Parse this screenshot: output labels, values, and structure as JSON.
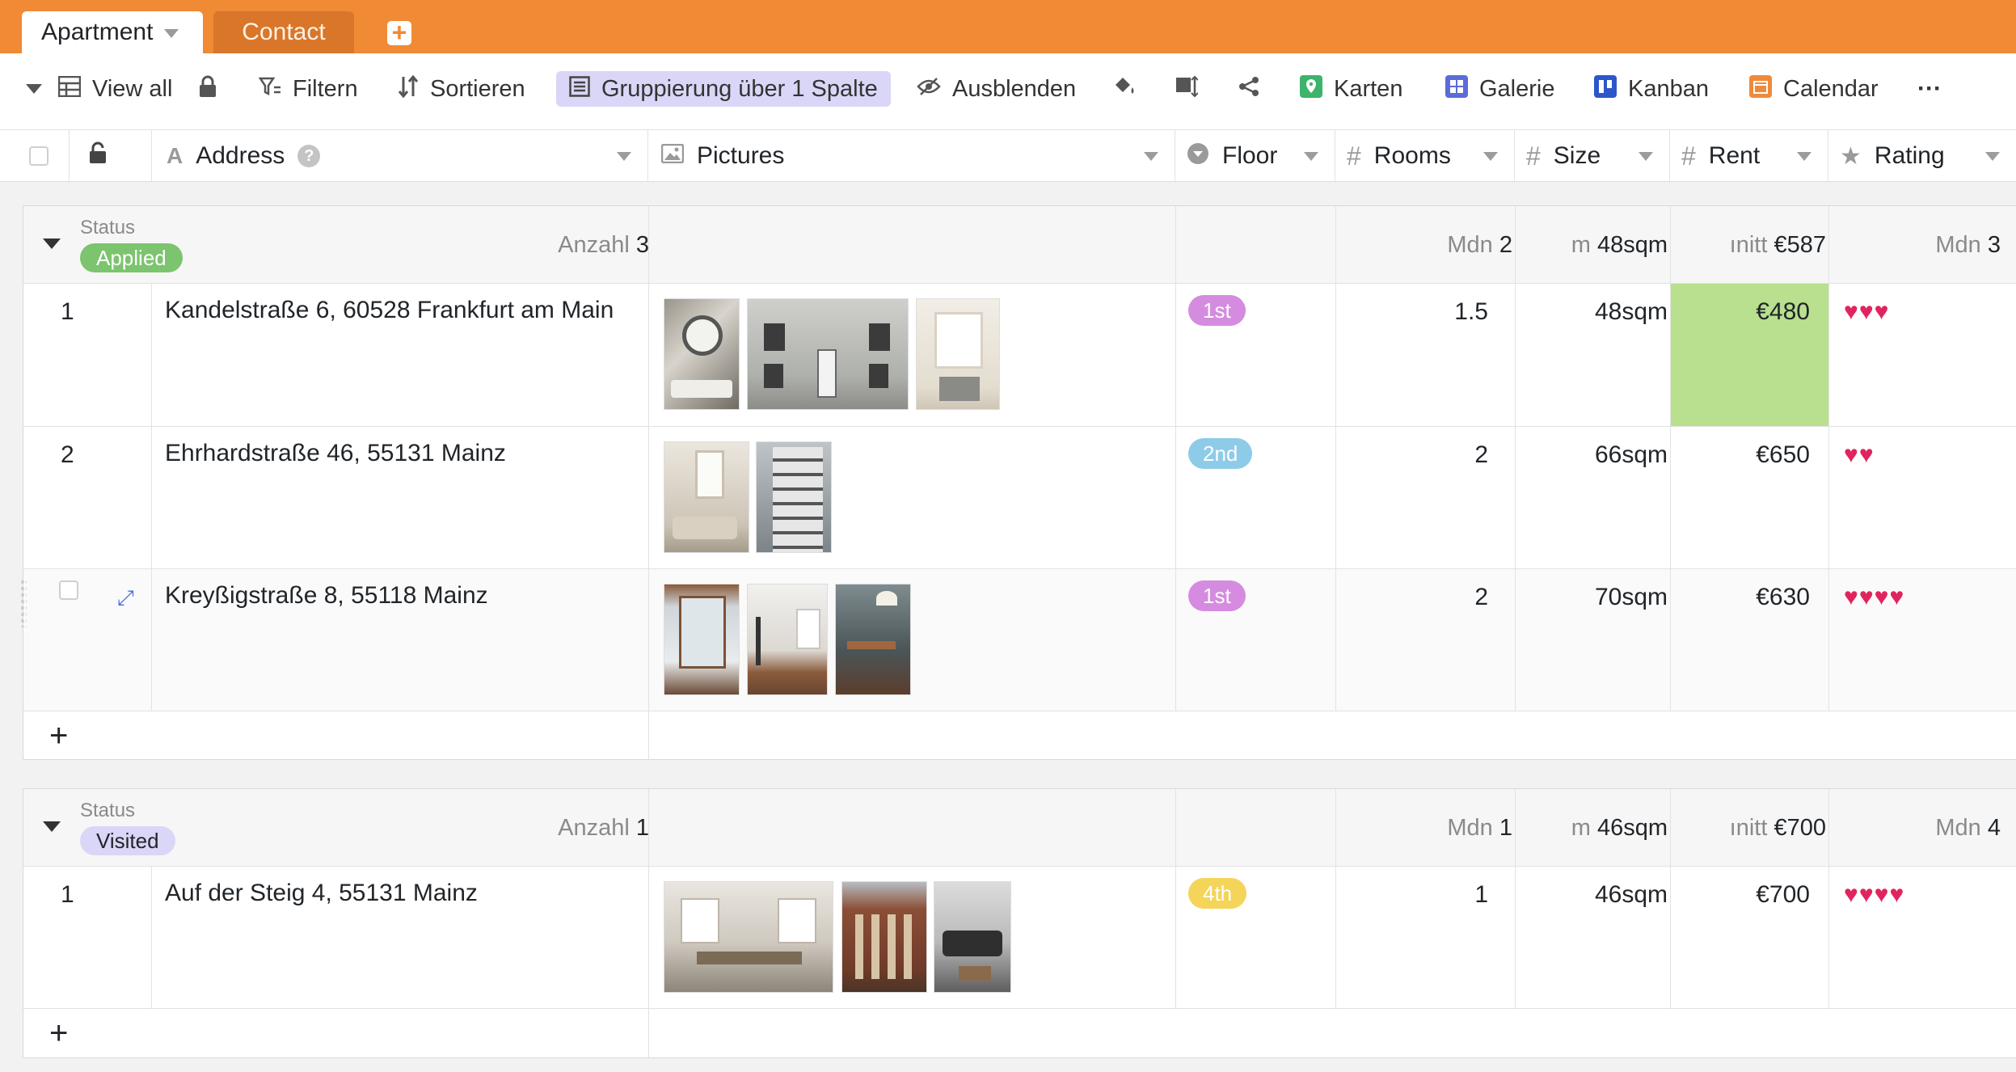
{
  "tabs": [
    {
      "label": "Apartment",
      "active": true
    },
    {
      "label": "Contact",
      "active": false
    }
  ],
  "toolbar": {
    "view_all": "View all",
    "filter": "Filtern",
    "sort": "Sortieren",
    "group": "Gruppierung über 1 Spalte",
    "hide": "Ausblenden",
    "map": "Karten",
    "gallery": "Galerie",
    "kanban": "Kanban",
    "calendar": "Calendar",
    "more": "···"
  },
  "columns": {
    "address": "Address",
    "pictures": "Pictures",
    "floor": "Floor",
    "rooms": "Rooms",
    "size": "Size",
    "rent": "Rent",
    "rating": "Rating"
  },
  "colors": {
    "accent": "#f08a34",
    "applied": "#7cc46e",
    "visited": "#d9d6f7",
    "floor_1st": "#d58be0",
    "floor_2nd": "#8ecbe8",
    "floor_4th": "#f5d45a",
    "rent_highlight": "#b8e08e",
    "heart": "#e0245e"
  },
  "groups": [
    {
      "status_label": "Status",
      "status": "Applied",
      "count_label": "Anzahl",
      "count": "3",
      "rooms_prefix": "Mdn",
      "rooms_value": "2",
      "size_prefix": "m",
      "size_value": "48sqm",
      "rent_prefix": "ınitt",
      "rent_value": "€587",
      "rating_prefix": "Mdn",
      "rating_value": "3",
      "rows": [
        {
          "num": "1",
          "address": "Kandelstraße 6, 60528 Frankfurt am Main",
          "floor": "1st",
          "rooms": "1.5",
          "size": "48sqm",
          "rent": "€480",
          "hearts": "♥♥♥"
        },
        {
          "num": "2",
          "address": "Ehrhardstraße 46, 55131 Mainz",
          "floor": "2nd",
          "rooms": "2",
          "size": "66sqm",
          "rent": "€650",
          "hearts": "♥♥"
        },
        {
          "num": "",
          "address": "Kreyßigstraße 8, 55118 Mainz",
          "floor": "1st",
          "rooms": "2",
          "size": "70sqm",
          "rent": "€630",
          "hearts": "♥♥♥♥"
        }
      ],
      "add": "+"
    },
    {
      "status_label": "Status",
      "status": "Visited",
      "count_label": "Anzahl",
      "count": "1",
      "rooms_prefix": "Mdn",
      "rooms_value": "1",
      "size_prefix": "m",
      "size_value": "46sqm",
      "rent_prefix": "ınitt",
      "rent_value": "€700",
      "rating_prefix": "Mdn",
      "rating_value": "4",
      "rows": [
        {
          "num": "1",
          "address": "Auf der Steig 4, 55131 Mainz",
          "floor": "4th",
          "rooms": "1",
          "size": "46sqm",
          "rent": "€700",
          "hearts": "♥♥♥♥"
        }
      ],
      "add": "+"
    }
  ]
}
